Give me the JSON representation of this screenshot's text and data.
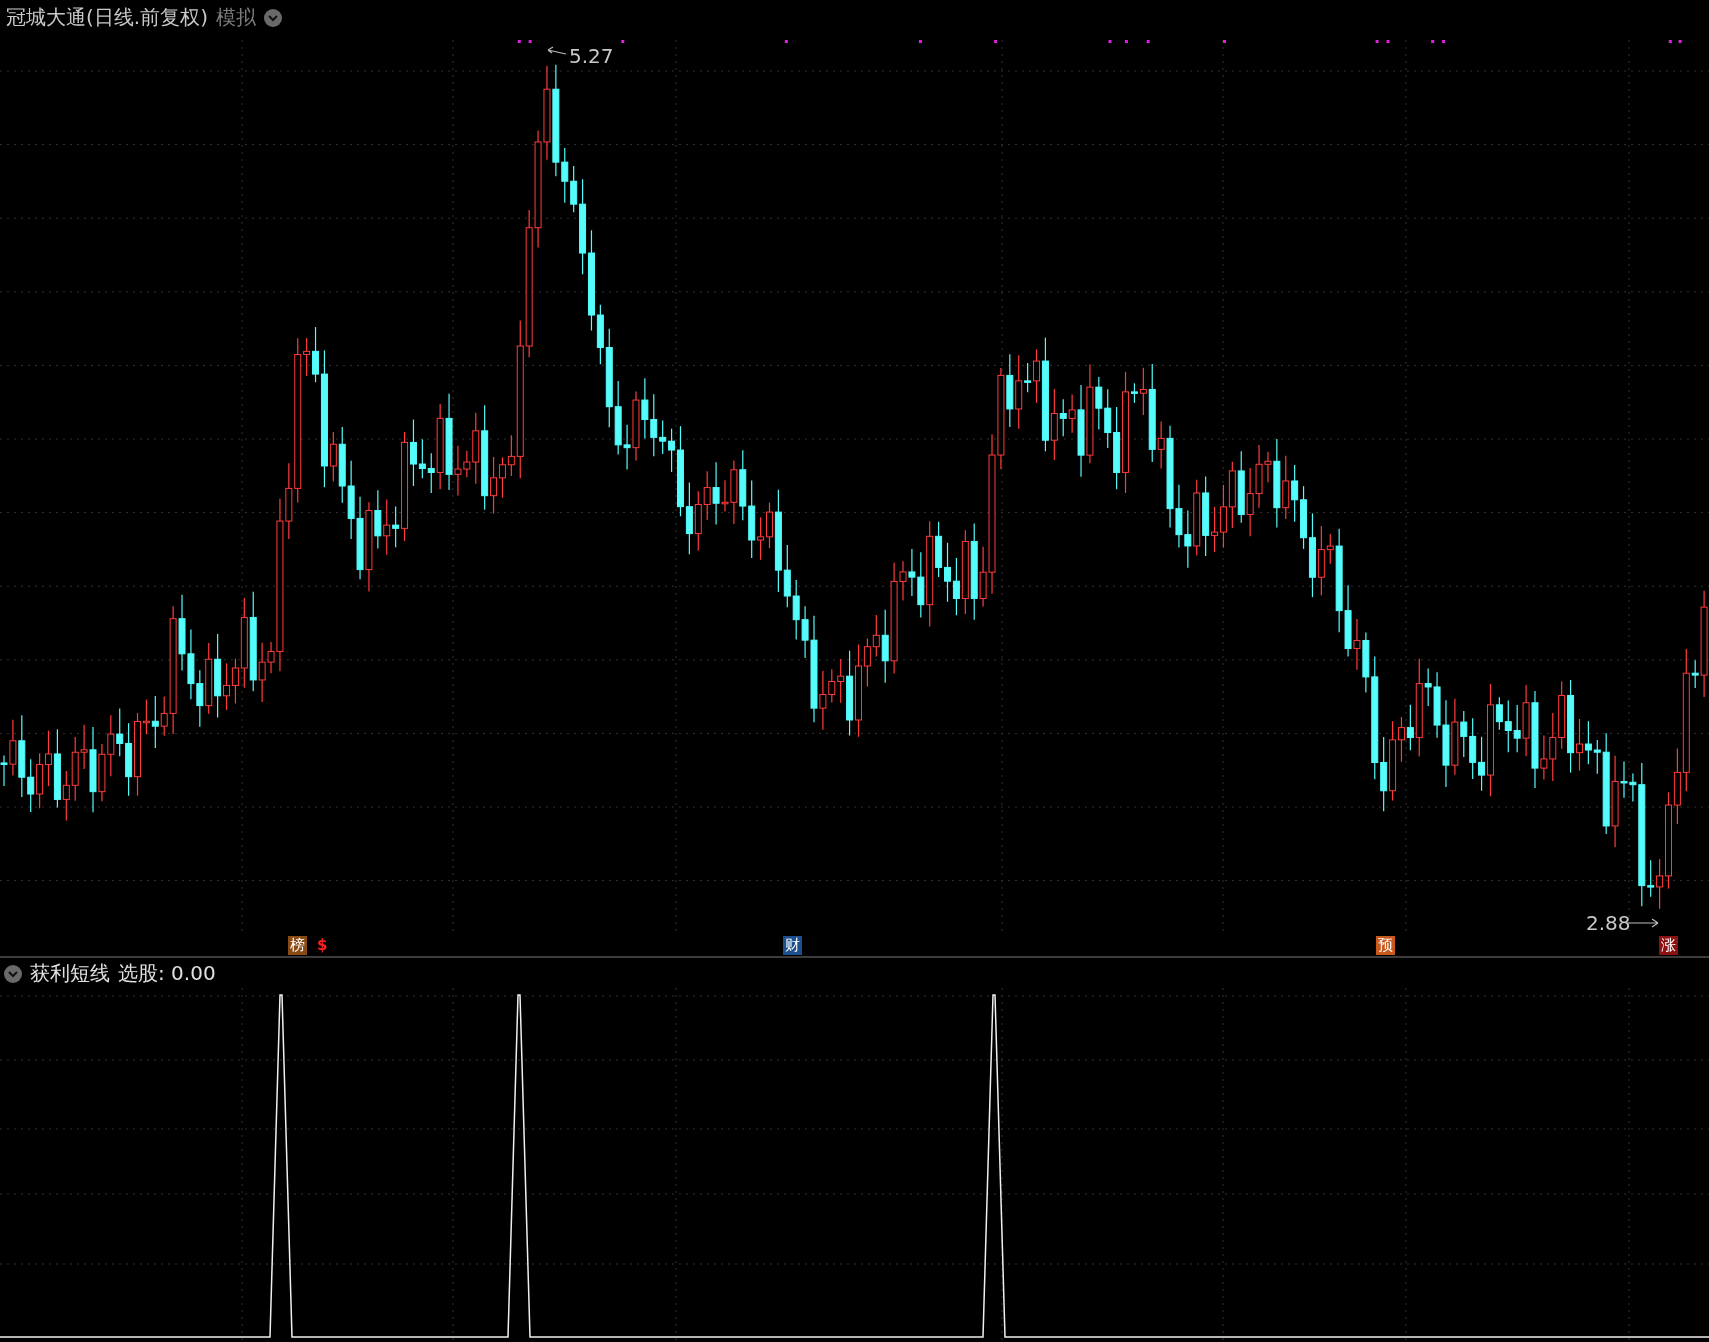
{
  "window": {
    "title": "冠城大通(日线.前复权)",
    "mode": "模拟"
  },
  "price_chart": {
    "high_label": "5.27",
    "low_label": "2.88",
    "event_markers": [
      {
        "label": "榜",
        "kind": "badge",
        "color": "#8a4a14"
      },
      {
        "label": "$",
        "kind": "symbol",
        "color": "#ff2020"
      },
      {
        "label": "财",
        "kind": "badge",
        "color": "#1c4f8c"
      },
      {
        "label": "预",
        "kind": "badge",
        "color": "#c8581c"
      },
      {
        "label": "涨",
        "kind": "badge",
        "color": "#8c1212"
      }
    ]
  },
  "indicator_panel": {
    "title": "获利短线",
    "readout": "选股: 0.00"
  }
}
